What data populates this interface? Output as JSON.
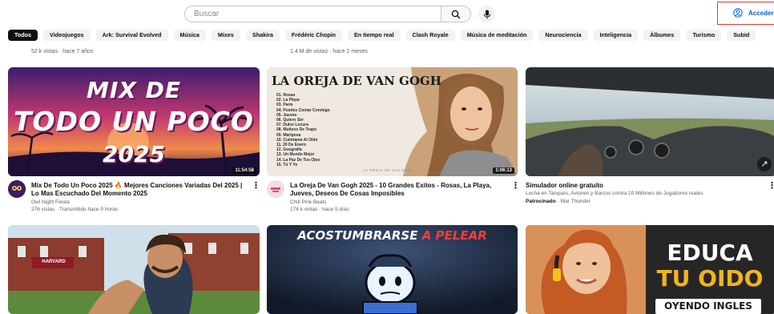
{
  "search": {
    "placeholder": "Buscar"
  },
  "header": {
    "signin_label": "Acceder"
  },
  "chips": [
    "Todos",
    "Videojuegos",
    "Ark: Survival Evolved",
    "Música",
    "Mixes",
    "Shakira",
    "Frédéric Chopin",
    "En tiempo real",
    "Clash Royale",
    "Música de meditación",
    "Neurociencia",
    "Inteligencia",
    "Álbumes",
    "Turismo",
    "Subid"
  ],
  "prev_row": [
    {
      "stats": "52 k vistas · hace 7 años"
    },
    {
      "stats": "1.4 M de vistas · hace 2 meses"
    }
  ],
  "videos": [
    {
      "thumb_line1": "MIX DE",
      "thumb_line2": "TODO UN POCO",
      "thumb_line3": "2025",
      "duration": "11:54:58",
      "title": "Mix De Todo Un Poco 2025 🔥 Mejores Canciones Variadas Del 2025 | Lo Mas Escuchado Del Momento 2025",
      "channel": "Owl Night Fiesta",
      "stats": "276 vistas · Transmitido hace 9 horas"
    },
    {
      "thumb_title": "LA OREJA DE VAN GOGH",
      "tracklist": [
        "01. Rosas",
        "02. La Playa",
        "03. París",
        "04. Puedes Contar Conmigo",
        "05. Jueves",
        "06. Quiero Ser",
        "07. Dulce Locura",
        "08. Muñeco De Trapo",
        "09. Mariposa",
        "10. Cuéntame Al Oído",
        "11. 20 De Enero",
        "12. Geografía",
        "13. Un Mundo Mejor",
        "14. La Paz De Tus Ojos",
        "15. Tú Y Yo"
      ],
      "thumb_footer": "LA OREJA DE VAN GOGH",
      "duration": "1:06:13",
      "title": "La Oreja De Van Gogh 2025 - 10 Grandes Exitos - Rosas, La Playa, Jueves, Deseos De Cosas Imposibles",
      "channel": "Chill Pink Beats",
      "stats": "174 k vistas · hace 5 días"
    },
    {
      "title": "Simulador online gratuito",
      "description": "Lucha en Tanques, Aviones y Barcos contra 10 Millones de Jugadores reales",
      "sponsored_label": "Patrocinado",
      "advertiser": "War Thunder"
    },
    {
      "thumb_sign": "HARVARD"
    },
    {
      "thumb_line1": "ACOSTUMBRARSE",
      "thumb_line2": "A PELEAR"
    },
    {
      "thumb_line1": "EDUCA",
      "thumb_line2": "TU OIDO",
      "thumb_line3": "OYENDO INGLES"
    }
  ]
}
